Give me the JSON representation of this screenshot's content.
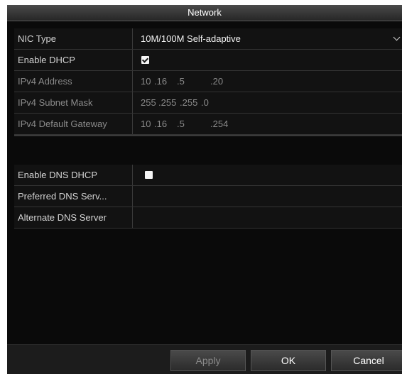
{
  "dialog": {
    "title": "Network"
  },
  "fields": {
    "nic_type": {
      "label": "NIC Type",
      "value": "10M/100M Self-adaptive"
    },
    "enable_dhcp": {
      "label": "Enable DHCP",
      "checked": true
    },
    "ipv4_address": {
      "label": "IPv4 Address",
      "octets": [
        "10",
        ".16",
        ".5",
        ".20"
      ]
    },
    "ipv4_subnet_mask": {
      "label": "IPv4 Subnet Mask",
      "octets": [
        "255",
        ".255",
        ".255",
        ".0"
      ]
    },
    "ipv4_default_gateway": {
      "label": "IPv4 Default Gateway",
      "octets": [
        "10",
        ".16",
        ".5",
        ".254"
      ]
    },
    "enable_dns_dhcp": {
      "label": "Enable DNS DHCP",
      "checked": false
    },
    "preferred_dns": {
      "label": "Preferred DNS Serv...",
      "value": ""
    },
    "alternate_dns": {
      "label": "Alternate DNS Server",
      "value": ""
    }
  },
  "buttons": {
    "apply": "Apply",
    "ok": "OK",
    "cancel": "Cancel"
  },
  "icons": {
    "dropdown": "chevron-down-icon",
    "checkbox_checked": "checkmark-icon"
  },
  "colors": {
    "background": "#0a0a0a",
    "titlebar": "#333333",
    "disabled_text": "#8a8a8a",
    "text": "#f2f2f2"
  }
}
